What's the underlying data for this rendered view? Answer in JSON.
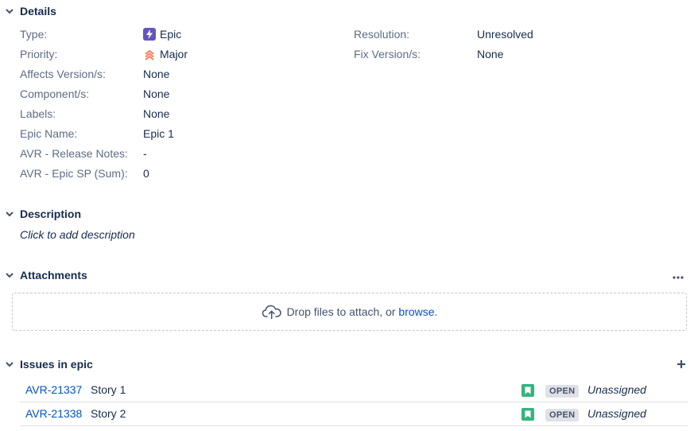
{
  "details": {
    "heading": "Details",
    "left_fields": [
      {
        "label": "Type:",
        "value": "Epic"
      },
      {
        "label": "Priority:",
        "value": "Major"
      },
      {
        "label": "Affects Version/s:",
        "value": "None"
      },
      {
        "label": "Component/s:",
        "value": "None"
      },
      {
        "label": "Labels:",
        "value": "None"
      },
      {
        "label": "Epic Name:",
        "value": "Epic 1"
      },
      {
        "label": "AVR - Release Notes:",
        "value": "-"
      },
      {
        "label": "AVR - Epic SP (Sum):",
        "value": "0"
      }
    ],
    "right_fields": [
      {
        "label": "Resolution:",
        "value": "Unresolved"
      },
      {
        "label": "Fix Version/s:",
        "value": "None"
      }
    ],
    "type_icon": "lightning-icon",
    "type_color": "#6554c0",
    "priority_icon": "priority-major-icon",
    "priority_color": "#ff7452"
  },
  "description": {
    "heading": "Description",
    "placeholder": "Click to add description"
  },
  "attachments": {
    "heading": "Attachments",
    "more_icon": "more-icon",
    "drop_text": "Drop files to attach, or ",
    "browse_link": "browse",
    "drop_suffix": ".",
    "upload_icon": "cloud-upload-icon"
  },
  "issues_in_epic": {
    "heading": "Issues in epic",
    "add_icon": "plus-icon",
    "rows": [
      {
        "key": "AVR-21337",
        "summary": "Story 1",
        "type_icon": "story-icon",
        "status": "OPEN",
        "assignee": "Unassigned"
      },
      {
        "key": "AVR-21338",
        "summary": "Story 2",
        "type_icon": "story-icon",
        "status": "OPEN",
        "assignee": "Unassigned"
      }
    ]
  },
  "colors": {
    "link": "#0052cc",
    "story": "#36b37e",
    "status_bg": "#dfe1e6",
    "label": "#5e6c84",
    "text": "#172b4d"
  }
}
